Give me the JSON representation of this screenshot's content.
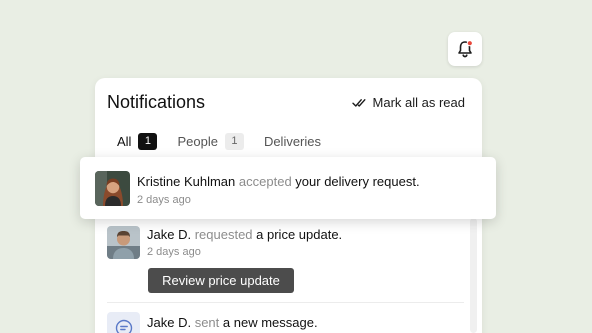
{
  "header": {
    "bell_icon": "bell-icon",
    "bell_badge_color": "#e8463a"
  },
  "panel": {
    "title": "Notifications",
    "mark_all_read_label": "Mark all as read",
    "mark_all_read_icon": "double-check-icon"
  },
  "tabs": [
    {
      "label": "All",
      "count": "1",
      "active": true
    },
    {
      "label": "People",
      "count": "1",
      "active": false
    },
    {
      "label": "Deliveries",
      "count": null,
      "active": false
    }
  ],
  "notifications": [
    {
      "actor": "Kristine Kuhlman",
      "verb": "accepted",
      "object": "your delivery request.",
      "time": "2 days ago",
      "avatar": "avatar-photo"
    },
    {
      "actor": "Jake D.",
      "verb": "requested",
      "object": "a price update.",
      "time": "2 days ago",
      "avatar": "avatar-photo",
      "action_label": "Review price update"
    },
    {
      "actor": "Jake D.",
      "verb": "sent",
      "object": "a new message.",
      "icon": "message-icon"
    }
  ],
  "colors": {
    "background": "#e9eee4",
    "accent_dark": "#111111",
    "button_bg": "#4c4c4c",
    "message_icon_bg": "#e8ecf6",
    "message_icon_fg": "#5a79c8"
  }
}
